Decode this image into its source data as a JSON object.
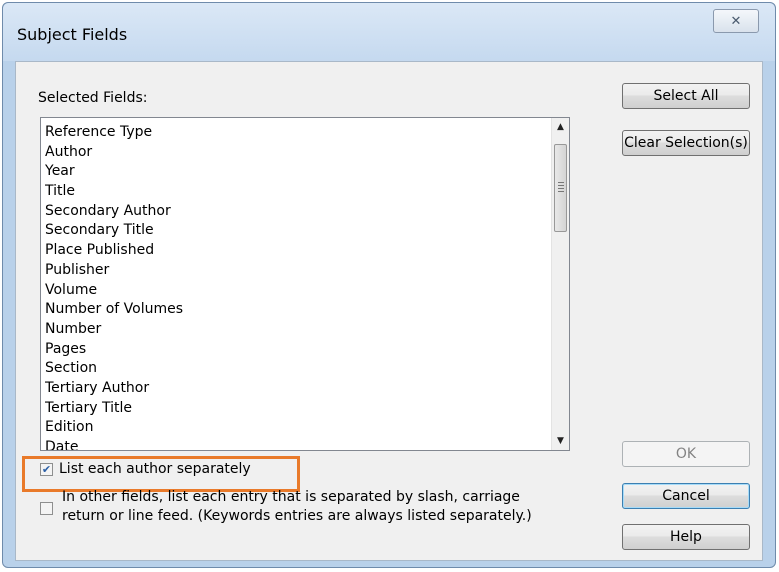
{
  "dialog": {
    "title": "Subject Fields",
    "close_icon": "close-icon",
    "close_glyph": "✕"
  },
  "selected_fields": {
    "label": "Selected Fields:",
    "items": [
      "Reference Type",
      "Author",
      "Year",
      "Title",
      "Secondary Author",
      "Secondary Title",
      "Place Published",
      "Publisher",
      "Volume",
      "Number of Volumes",
      "Number",
      "Pages",
      "Section",
      "Tertiary Author",
      "Tertiary Title",
      "Edition",
      "Date"
    ]
  },
  "options": {
    "list_authors_label": "List each author separately",
    "list_authors_checked": true,
    "list_other_label_line1": "In other fields, list each entry that is separated by slash, carriage",
    "list_other_label_line2": "return or line feed. (Keywords entries are always listed separately.)",
    "list_other_checked": false
  },
  "buttons": {
    "select_all": "Select All",
    "clear_selection": "Clear Selection(s)",
    "ok": "OK",
    "cancel": "Cancel",
    "help": "Help"
  },
  "colors": {
    "highlight": "#e97a2a",
    "frame": "#b9d1ea"
  }
}
